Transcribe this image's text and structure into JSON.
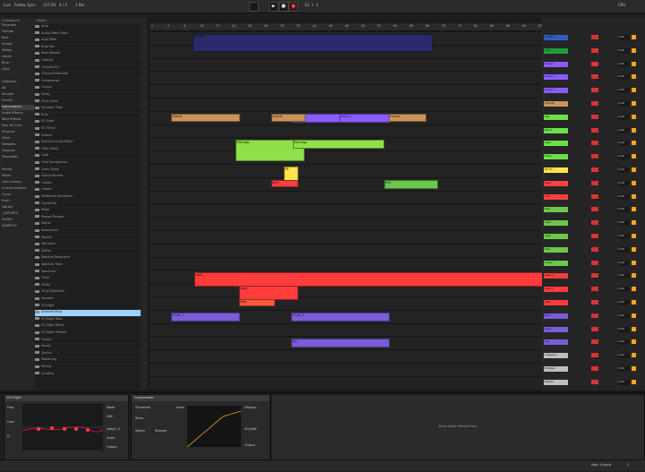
{
  "topbar": {
    "menu": [
      "Live",
      "Follow",
      "Sync"
    ],
    "tempo": "127.00",
    "signature": "4 / 4",
    "bar_pos": "1 Bar",
    "position": "22. 1. 1",
    "cpu": "CPU"
  },
  "browser": {
    "places_header": "Collections",
    "places": [
      "Favorites",
      "Orange",
      "Red",
      "Purple",
      "Yellow",
      "Green",
      "Blue",
      "Gray",
      "",
      "Category",
      "All",
      "Sounds",
      "Drums",
      "Instruments",
      "Audio Effects",
      "MIDI Effects",
      "Max for Live",
      "Plug-Ins",
      "Clips",
      "Samples",
      "Grooves",
      "Templates",
      "",
      "Places",
      "Packs",
      "User Library",
      "Current Project",
      "Cloud",
      "Push",
      "Library",
      "_EXPORTS",
      "AUDIO",
      "SAMPLES"
    ],
    "tree_header": "Name",
    "tree": [
      "Amp",
      "Audio Effect Rack",
      "Auto Filter",
      "Auto Pan",
      "Beat Repeat",
      "Cabinet",
      "Channel EQ",
      "Chorus-Ensemble",
      "Compressor",
      "Corpus",
      "Delay",
      "Drum Buss",
      "Dynamic Tube",
      "Echo",
      "EQ Eight",
      "EQ Three",
      "Erosion",
      "External Audio Effect",
      "Filter Delay",
      "Gate",
      "Glue Compressor",
      "Grain Delay",
      "Hybrid Reverb",
      "Limiter",
      "Looper",
      "Multiband Dynamics",
      "Overdrive",
      "Pedal",
      "Phaser-Flanger",
      "Redux",
      "Resonators",
      "Reverb",
      "Saturator",
      "Shifter",
      "Spectral Resonator",
      "Spectral Time",
      "Spectrum",
      "Tuner",
      "Utility",
      "Vinyl Distortion",
      "Vocoder",
      "EQ Eight",
      "Channel Strip",
      "EQ Eight Tools",
      "EQ Eight Filters",
      "EQ Eight Presets",
      "Drums",
      "Vocals",
      "Synths",
      "Mastering",
      "Mixing",
      "Creative"
    ],
    "tree_selected": 42
  },
  "arrangement": {
    "markers": [
      "1",
      "5",
      "9",
      "13",
      "17",
      "21",
      "25",
      "29",
      "33",
      "37",
      "41",
      "45",
      "49",
      "53",
      "57",
      "61",
      "65",
      "69",
      "73",
      "77",
      "81",
      "85",
      "89",
      "93",
      "97"
    ],
    "clips": [
      {
        "label": "EQ Eight",
        "color": "#2b2b6b"
      },
      {
        "label": "Vocal_1",
        "color": "#8a5cff"
      },
      {
        "label": "Vocal_2",
        "color": "#8a5cff"
      },
      {
        "label": "Chords",
        "color": "#c9955a"
      },
      {
        "label": "Chords",
        "color": "#c9955a"
      },
      {
        "label": "Chords",
        "color": "#c9955a"
      },
      {
        "label": "Pad Loop",
        "color": "#8fe04a"
      },
      {
        "label": "Pad Loop",
        "color": "#8fe04a"
      },
      {
        "label": "Fill",
        "color": "#ffe44a"
      },
      {
        "label": "Bass",
        "color": "#ff4040"
      },
      {
        "label": "Perc",
        "color": "#6cc84c"
      },
      {
        "label": "Lead",
        "color": "#ff3b3b"
      },
      {
        "label": "Lead",
        "color": "#ff3b3b"
      },
      {
        "label": "Stab",
        "color": "#ff5a3b"
      },
      {
        "label": "FX Hit_1",
        "color": "#7a5cd8"
      },
      {
        "label": "FX Hit_2",
        "color": "#7a5cd8"
      },
      {
        "label": "Arp",
        "color": "#7a5cd8"
      }
    ]
  },
  "mixer": {
    "master_label": "Master",
    "tracks": [
      {
        "name": "Ableton",
        "color": "#2f5fc4"
      },
      {
        "name": "Intro",
        "color": "#1e9e3c"
      },
      {
        "name": "Vocal 1",
        "color": "#8a5cff"
      },
      {
        "name": "Vocal 2",
        "color": "#8a5cff"
      },
      {
        "name": "Vocal 3",
        "color": "#8a5cff"
      },
      {
        "name": "Chords",
        "color": "#c9955a"
      },
      {
        "name": "Pad",
        "color": "#6ee04a"
      },
      {
        "name": "Pad 2",
        "color": "#6ee04a"
      },
      {
        "name": "Keys",
        "color": "#6ee04a"
      },
      {
        "name": "Pluck",
        "color": "#6ee04a"
      },
      {
        "name": "Fill FX",
        "color": "#ffe44a"
      },
      {
        "name": "Bass",
        "color": "#ff4040"
      },
      {
        "name": "Sub",
        "color": "#ff4040"
      },
      {
        "name": "Perc",
        "color": "#6cc84c"
      },
      {
        "name": "Hats",
        "color": "#6cc84c"
      },
      {
        "name": "Clap",
        "color": "#6cc84c"
      },
      {
        "name": "Kick",
        "color": "#6cc84c"
      },
      {
        "name": "Snare",
        "color": "#6cc84c"
      },
      {
        "name": "Lead 1",
        "color": "#ff3b3b"
      },
      {
        "name": "Lead 2",
        "color": "#ff3b3b"
      },
      {
        "name": "Stab",
        "color": "#ff3b3b"
      },
      {
        "name": "FX 1",
        "color": "#7a5cd8"
      },
      {
        "name": "FX 2",
        "color": "#7a5cd8"
      },
      {
        "name": "Arp",
        "color": "#7a5cd8"
      },
      {
        "name": "A Reverb",
        "color": "#bfbfbf"
      },
      {
        "name": "B Delay",
        "color": "#bfbfbf"
      },
      {
        "name": "Master",
        "color": "#bfbfbf"
      }
    ],
    "vol_value": "0.00"
  },
  "devices": {
    "eq": {
      "title": "EQ Eight",
      "freq": "Freq",
      "gain": "Gain",
      "q": "Q",
      "mode": "Mode",
      "edit": "Edit",
      "adapt": "Adapt. Q",
      "scale": "Scale",
      "output": "Output"
    },
    "comp": {
      "title": "Compressor",
      "threshold": "Threshold",
      "ratio": "Ratio",
      "attack": "Attack",
      "release": "Release",
      "knee": "Knee",
      "makeup": "Makeup",
      "dry_wet": "Dry/Wet",
      "output": "Output"
    },
    "drop_text": "Drop Audio Effects Here"
  },
  "status": {
    "track": "Main Output",
    "cpu": "1"
  }
}
